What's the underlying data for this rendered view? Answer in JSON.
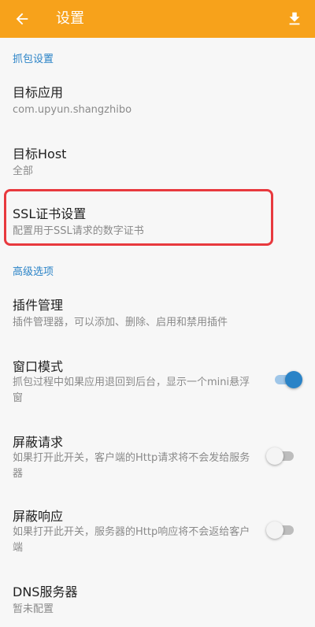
{
  "appbar": {
    "title": "设置",
    "back_icon": "arrow-left-icon",
    "download_icon": "download-icon",
    "color": "#f7a21b"
  },
  "categories": {
    "capture": "抓包设置",
    "advanced": "高级选项"
  },
  "items": {
    "target_app": {
      "title": "目标应用",
      "summary": "com.upyun.shangzhibo"
    },
    "target_host": {
      "title": "目标Host",
      "summary": "全部"
    },
    "ssl_cert": {
      "title": "SSL证书设置",
      "summary": "配置用于SSL请求的数字证书"
    },
    "plugin_mgr": {
      "title": "插件管理",
      "summary": "插件管理器，可以添加、删除、启用和禁用插件"
    },
    "window_mode": {
      "title": "窗口模式",
      "summary": "抓包过程中如果应用退回到后台，显示一个mini悬浮窗",
      "enabled": true
    },
    "block_request": {
      "title": "屏蔽请求",
      "summary": "如果打开此开关，客户端的Http请求将不会发给服务器",
      "enabled": false
    },
    "block_response": {
      "title": "屏蔽响应",
      "summary": "如果打开此开关，服务器的Http响应将不会返给客户端",
      "enabled": false
    },
    "dns_server": {
      "title": "DNS服务器",
      "summary": "暂未配置"
    }
  },
  "colors": {
    "accent": "#2a83c7",
    "highlight_border": "#e8393e"
  }
}
